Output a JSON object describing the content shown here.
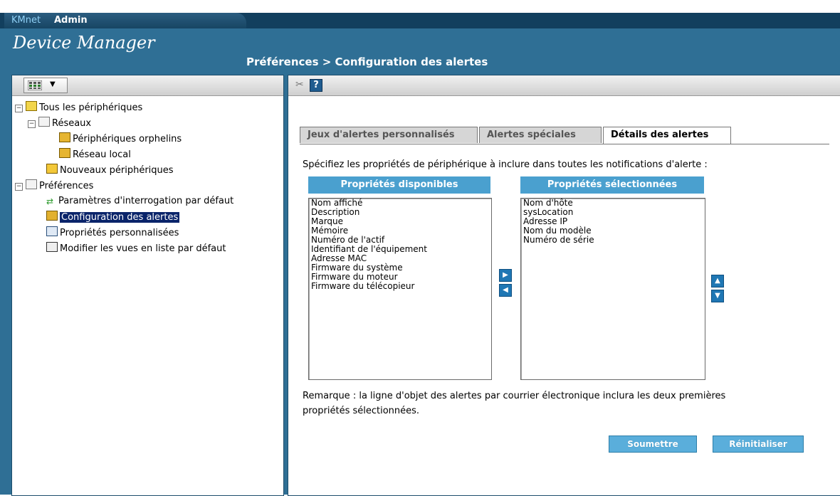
{
  "header": {
    "brand_prefix": "KMnet",
    "brand_suffix": "Admin",
    "app_title": "Device Manager",
    "breadcrumb": "Préférences > Configuration des alertes"
  },
  "sidebar": {
    "tree": [
      {
        "label": "Tous les périphériques",
        "icon": "devices-folder-icon"
      },
      {
        "label": "Réseaux",
        "icon": "folder-icon"
      },
      {
        "label": "Périphériques orphelins",
        "icon": "network-icon"
      },
      {
        "label": "Réseau local",
        "icon": "network-icon"
      },
      {
        "label": "Nouveaux périphériques",
        "icon": "new-devices-icon"
      },
      {
        "label": "Préférences",
        "icon": "folder-icon"
      },
      {
        "label": "Paramètres d'interrogation par défaut",
        "icon": "polling-arrows-icon"
      },
      {
        "label": "Configuration des alertes",
        "icon": "alert-config-icon"
      },
      {
        "label": "Propriétés personnalisées",
        "icon": "properties-icon"
      },
      {
        "label": "Modifier les vues en liste par défaut",
        "icon": "list-view-icon"
      }
    ]
  },
  "tabs": [
    {
      "label": "Jeux d'alertes personnalisés"
    },
    {
      "label": "Alertes spéciales"
    },
    {
      "label": "Détails des alertes"
    }
  ],
  "content": {
    "instruction": "Spécifiez les propriétés de périphérique à inclure dans toutes les notifications d'alerte :",
    "available_header": "Propriétés disponibles",
    "selected_header": "Propriétés sélectionnées",
    "available": [
      "Nom affiché",
      "Description",
      "Marque",
      "Mémoire",
      "Numéro de l'actif",
      "Identifiant de l'équipement",
      "Adresse MAC",
      "Firmware du système",
      "Firmware du moteur",
      "Firmware du télécopieur"
    ],
    "selected": [
      "Nom d'hôte",
      "sysLocation",
      "Adresse IP",
      "Nom du modèle",
      "Numéro de série"
    ],
    "note_line1": "Remarque : la ligne d'objet des alertes par courrier électronique inclura les deux premières",
    "note_line2": "propriétés sélectionnées.",
    "submit_label": "Soumettre",
    "reset_label": "Réinitialiser",
    "help_label": "?"
  },
  "colors": {
    "frame": "#2f6f95",
    "header_bar": "#4aa0cf",
    "selection": "#0a246a"
  }
}
